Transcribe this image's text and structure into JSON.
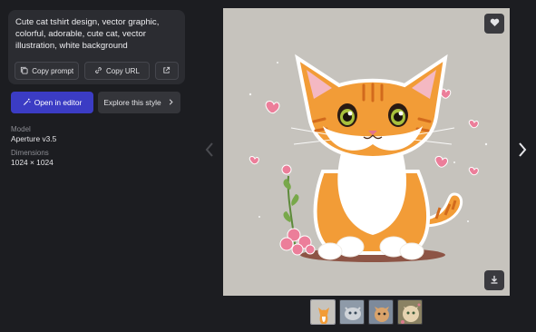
{
  "prompt": {
    "text": "Cute cat tshirt design, vector graphic,\ncolorful, adorable, cute cat, vector\nillustration, white background",
    "copy_prompt_label": "Copy prompt",
    "copy_url_label": "Copy URL"
  },
  "actions": {
    "editor_label": "Open in editor",
    "explore_label": "Explore this style"
  },
  "meta": {
    "model_label": "Model",
    "model_value": "Aperture v3.5",
    "dimensions_label": "Dimensions",
    "dimensions_value": "1024 × 1024"
  },
  "icons": [
    "copy-icon",
    "link-icon",
    "external-link-icon",
    "wand-icon",
    "chevron-right-icon",
    "chevron-left-icon",
    "heart-icon",
    "download-icon"
  ],
  "colors": {
    "background": "#1c1d21",
    "panel": "#2b2c31",
    "accent": "#3b3cc4",
    "image_bg": "#c6c3bd"
  },
  "thumbnails": [
    {
      "label": "cat orange",
      "active": true
    },
    {
      "label": "cat grey",
      "active": false
    },
    {
      "label": "cat tabby",
      "active": false
    },
    {
      "label": "cat beige",
      "active": false
    }
  ]
}
